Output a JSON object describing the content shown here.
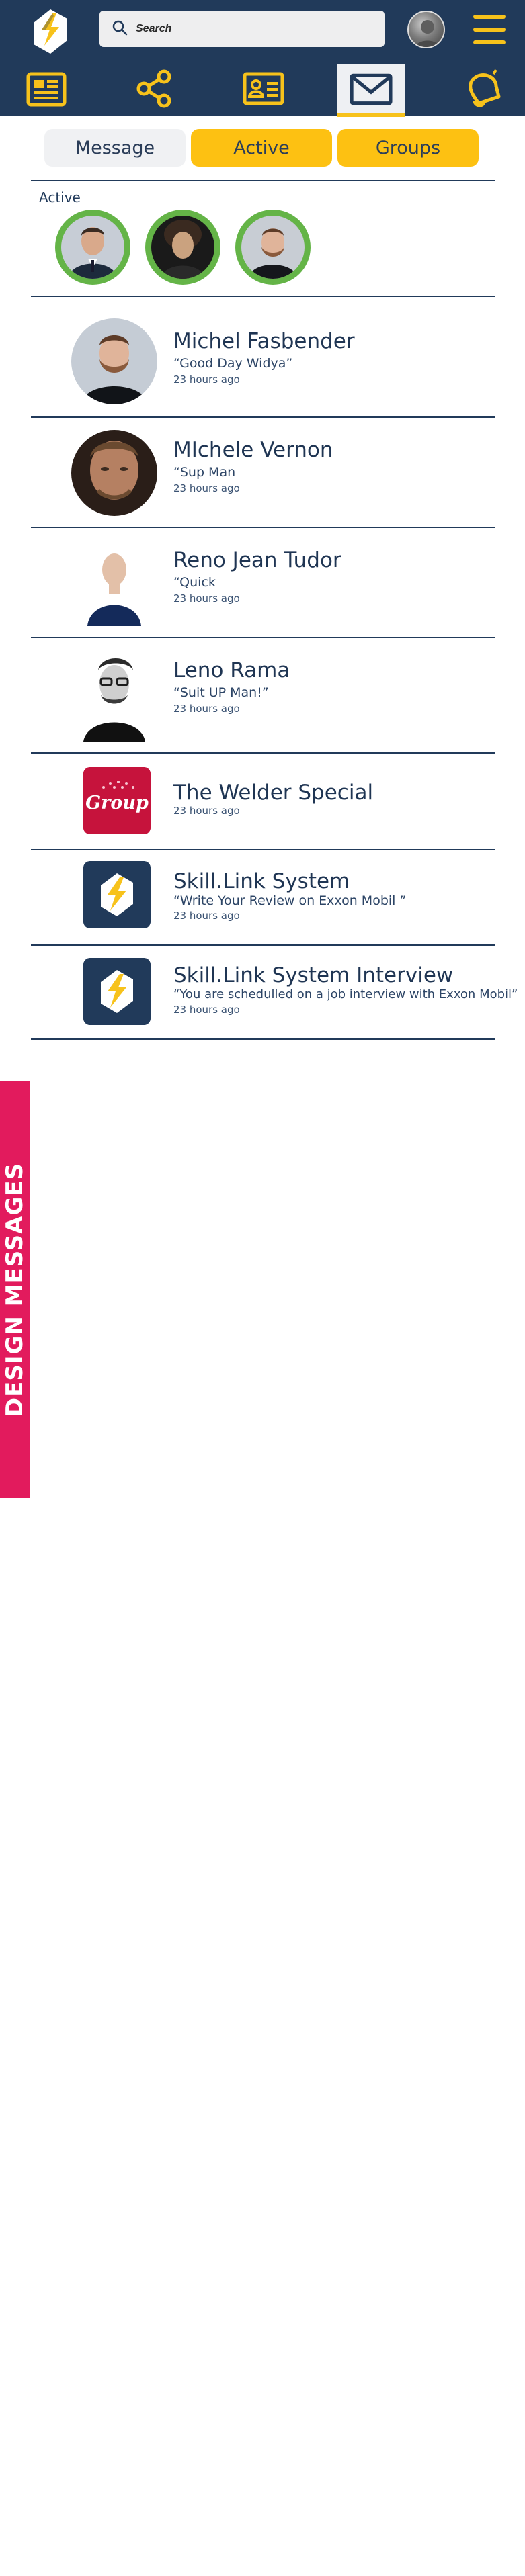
{
  "header": {
    "search_placeholder": "Search",
    "colors": {
      "navy": "#213a5a",
      "yellow": "#f7c21b",
      "green": "#64b447",
      "pink": "#e21b5d"
    },
    "nav_items": [
      {
        "icon": "newspaper-icon"
      },
      {
        "icon": "share-icon"
      },
      {
        "icon": "id-card-icon"
      },
      {
        "icon": "envelope-icon",
        "active": true
      },
      {
        "icon": "bell-icon"
      }
    ]
  },
  "tabs": {
    "message": "Message",
    "active": "Active",
    "groups": "Groups"
  },
  "active_section": {
    "label": "Active"
  },
  "messages": [
    {
      "name": "Michel Fasbender",
      "preview": "“Good Day Widya”",
      "time": "23 hours ago"
    },
    {
      "name": "MIchele Vernon",
      "preview": "“Sup Man",
      "time": "23 hours ago"
    },
    {
      "name": "Reno Jean Tudor",
      "preview": "“Quick",
      "time": "23 hours ago"
    },
    {
      "name": "Leno Rama",
      "preview": "“Suit UP Man!”",
      "time": "23 hours ago"
    },
    {
      "name": "The Welder Special",
      "logo_text": "Group",
      "time": "23 hours ago"
    },
    {
      "name": "Skill.Link System",
      "preview": "“Write Your Review on Exxon Mobil ”",
      "time": "23 hours ago"
    },
    {
      "name": "Skill.Link System Interview",
      "preview": "“You are schedulled on a job interview with Exxon Mobil”",
      "time": "23 hours ago"
    }
  ],
  "ribbon": {
    "text": "DESIGN MESSAGES"
  }
}
